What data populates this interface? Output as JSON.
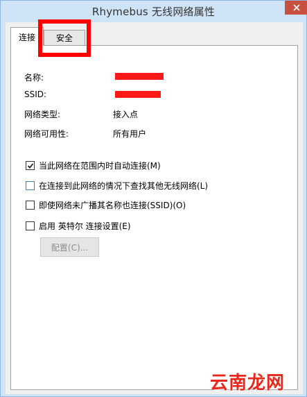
{
  "window": {
    "title": "Rhymebus 无线网络属性"
  },
  "tabs": [
    {
      "label": "连接",
      "active": true
    },
    {
      "label": "安全",
      "active": false
    }
  ],
  "info": [
    {
      "label": "名称:",
      "value": "",
      "redacted": true
    },
    {
      "label": "SSID:",
      "value": "",
      "redacted": true
    },
    {
      "label": "网络类型:",
      "value": "接入点"
    },
    {
      "label": "网络可用性:",
      "value": "所有用户"
    }
  ],
  "options": [
    {
      "label": "当此网络在范围内时自动连接(M)",
      "checked": true
    },
    {
      "label": "在连接到此网络的情况下查找其他无线网络(L)",
      "checked": false
    },
    {
      "label": "即使网络未广播其名称也连接(SSID)(O)",
      "checked": false
    },
    {
      "label": "启用 英特尔 连接设置(E)",
      "checked": false
    }
  ],
  "buttons": {
    "configure": "配置(C)..."
  },
  "watermark": "云南龙网",
  "colors": {
    "highlight_box": "#ff0000",
    "redaction": "#ff1a1a",
    "title_bar": "#cfe3f6",
    "close_button": "#c7503f"
  }
}
